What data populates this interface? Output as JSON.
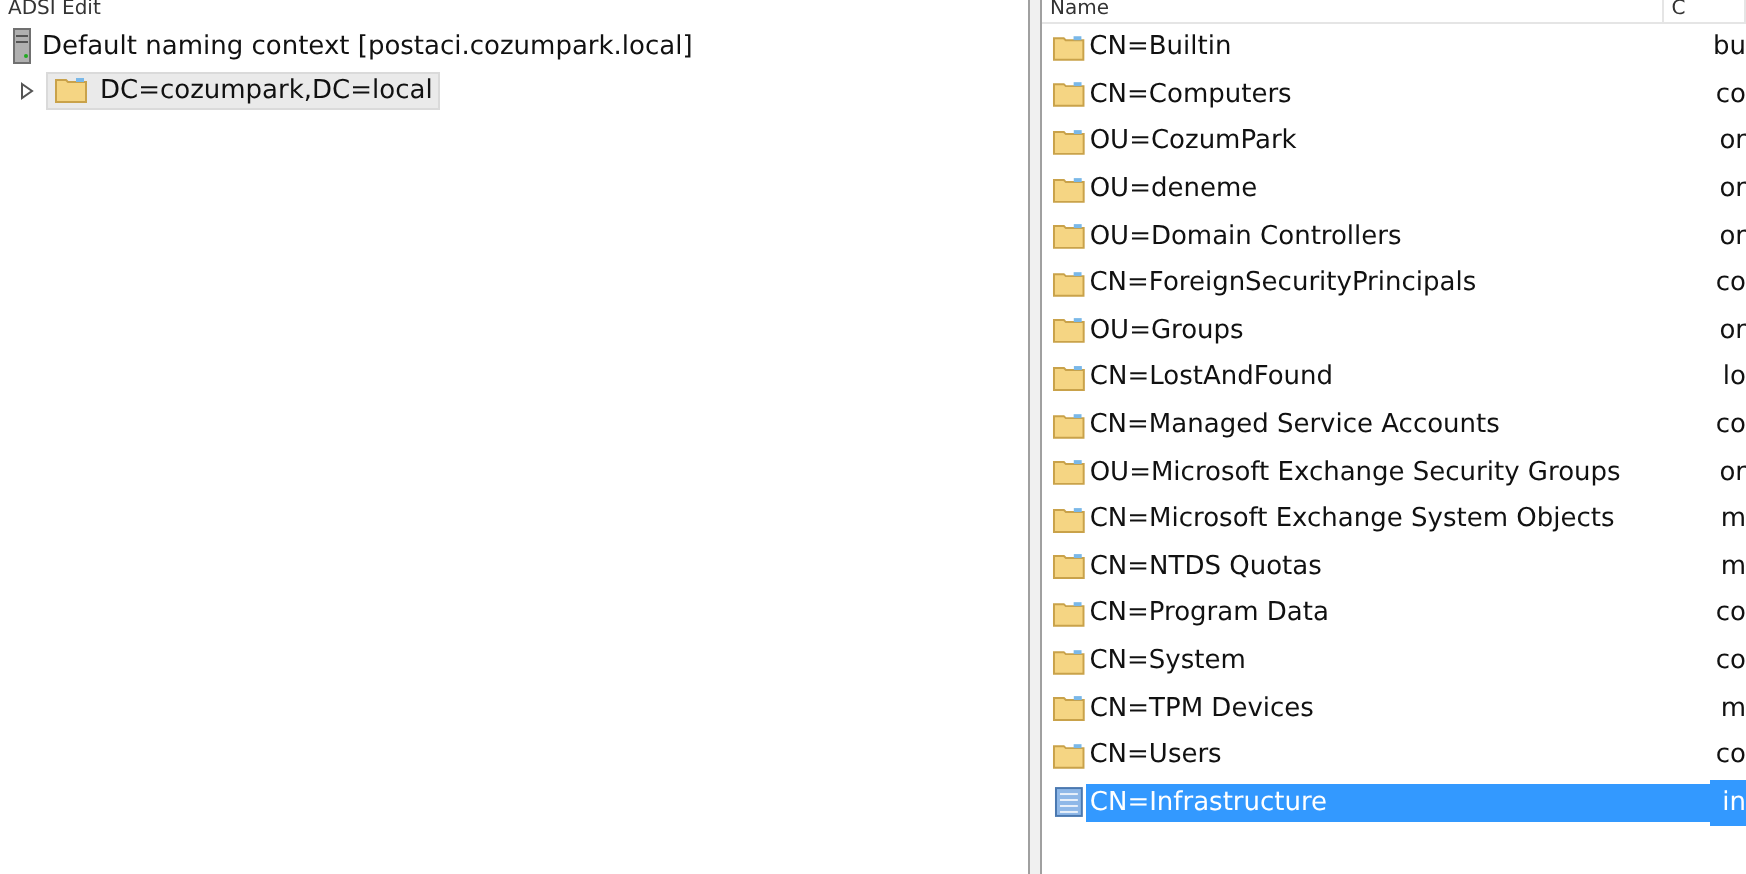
{
  "window": {
    "title": "ADSI Edit"
  },
  "tree": {
    "label": "Default naming context [postaci.cozumpark.local]",
    "children": [
      {
        "label": "DC=cozumpark,DC=local",
        "expanded": false,
        "selected": true
      }
    ]
  },
  "list": {
    "columns": [
      "Name",
      "C"
    ],
    "rows": [
      {
        "name": "CN=Builtin",
        "column_2": "bu",
        "kind": "folder",
        "selected": false
      },
      {
        "name": "CN=Computers",
        "column_2": "co",
        "kind": "folder",
        "selected": false
      },
      {
        "name": "OU=CozumPark",
        "column_2": "or",
        "kind": "folder",
        "selected": false
      },
      {
        "name": "OU=deneme",
        "column_2": "or",
        "kind": "folder",
        "selected": false
      },
      {
        "name": "OU=Domain Controllers",
        "column_2": "or",
        "kind": "folder",
        "selected": false
      },
      {
        "name": "CN=ForeignSecurityPrincipals",
        "column_2": "co",
        "kind": "folder",
        "selected": false
      },
      {
        "name": "OU=Groups",
        "column_2": "or",
        "kind": "folder",
        "selected": false
      },
      {
        "name": "CN=LostAndFound",
        "column_2": "lo",
        "kind": "folder",
        "selected": false
      },
      {
        "name": "CN=Managed Service Accounts",
        "column_2": "co",
        "kind": "folder",
        "selected": false
      },
      {
        "name": "OU=Microsoft Exchange Security Groups",
        "column_2": "or",
        "kind": "folder",
        "selected": false
      },
      {
        "name": "CN=Microsoft Exchange System Objects",
        "column_2": "m",
        "kind": "folder",
        "selected": false
      },
      {
        "name": "CN=NTDS Quotas",
        "column_2": "m",
        "kind": "folder",
        "selected": false
      },
      {
        "name": "CN=Program Data",
        "column_2": "co",
        "kind": "folder",
        "selected": false
      },
      {
        "name": "CN=System",
        "column_2": "co",
        "kind": "folder",
        "selected": false
      },
      {
        "name": "CN=TPM Devices",
        "column_2": "m",
        "kind": "folder",
        "selected": false
      },
      {
        "name": "CN=Users",
        "column_2": "co",
        "kind": "folder",
        "selected": false
      },
      {
        "name": "CN=Infrastructure",
        "column_2": "in",
        "kind": "object",
        "selected": true
      }
    ]
  }
}
